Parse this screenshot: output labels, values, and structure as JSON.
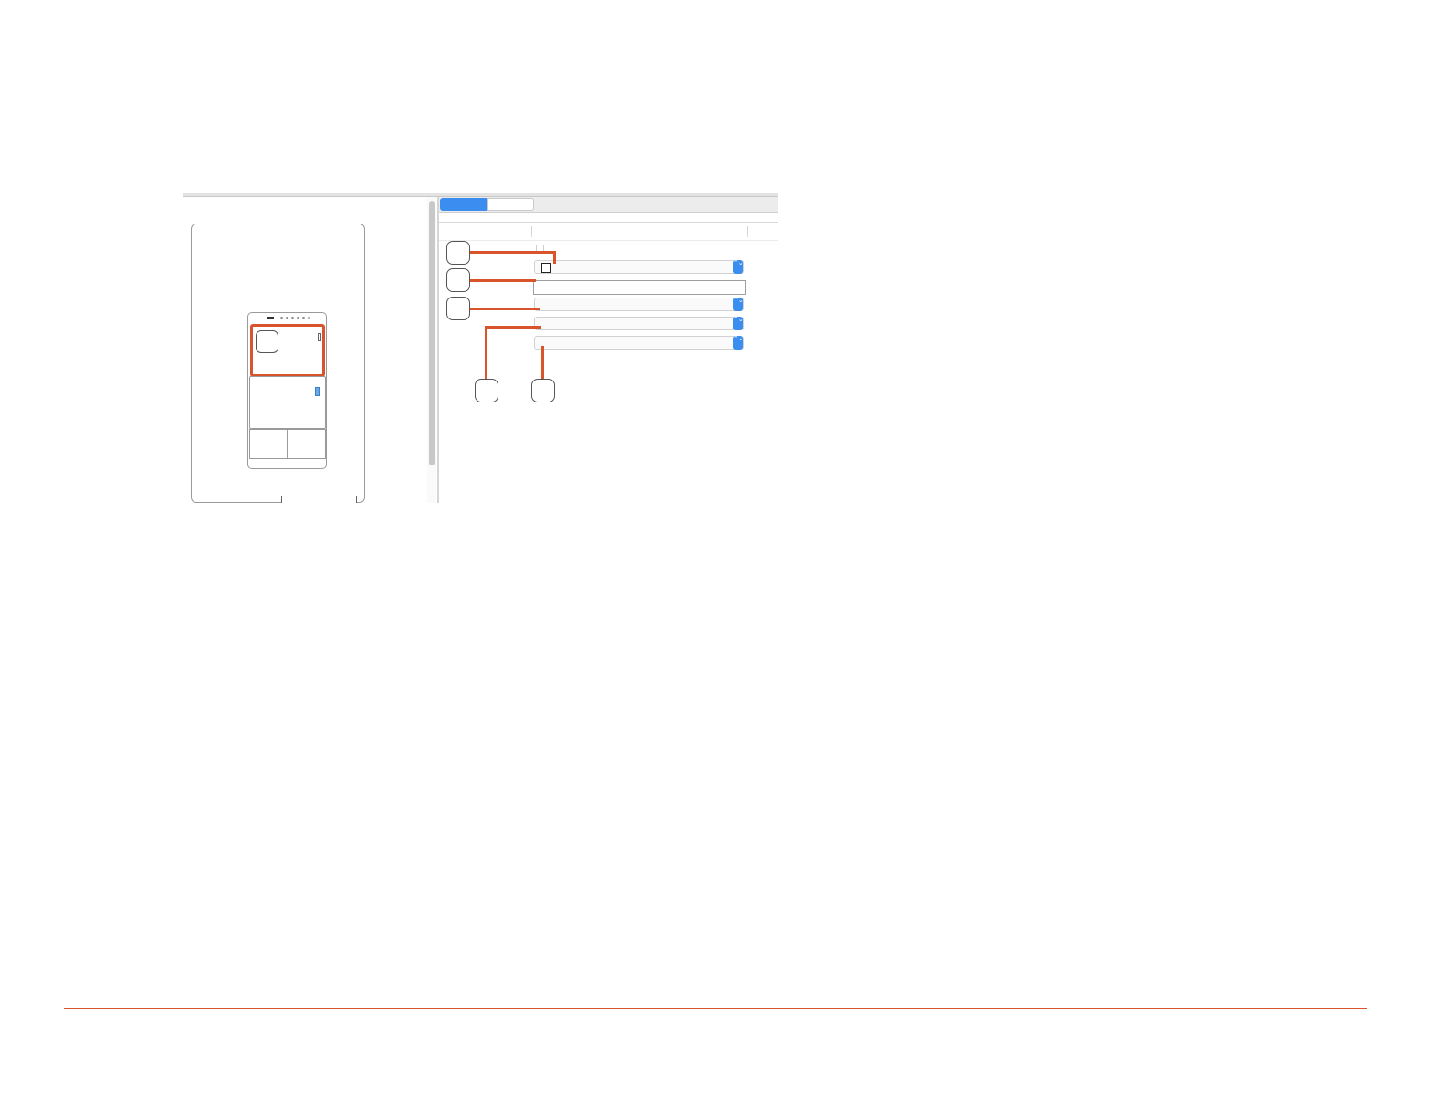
{
  "colors": {
    "callout_accent": "#d9542b",
    "selection_blue": "#3b8ef0",
    "switch_blue": "#6aa9e6",
    "divider_gray": "#d6d6d6"
  },
  "tabs": [
    {
      "label": "",
      "active": true
    },
    {
      "label": "",
      "active": false
    }
  ],
  "table_header": {
    "col1": "",
    "col2": "",
    "col3": ""
  },
  "form": {
    "checkbox_1_checked": false,
    "popup_1_value": "",
    "text_field_value": "",
    "popup_2_value": "",
    "popup_3_value": "",
    "popup_4_value": "",
    "stepper_glyph": "⌃⌄"
  },
  "callouts": [
    {
      "name": "callout-1",
      "label": ""
    },
    {
      "name": "callout-2",
      "label": ""
    },
    {
      "name": "callout-3",
      "label": ""
    },
    {
      "name": "callout-4",
      "label": ""
    },
    {
      "name": "callout-5",
      "label": ""
    },
    {
      "name": "callout-6",
      "label": ""
    }
  ],
  "icons": [
    "chevron-updown-icon",
    "camera-icon",
    "switch-icon"
  ]
}
